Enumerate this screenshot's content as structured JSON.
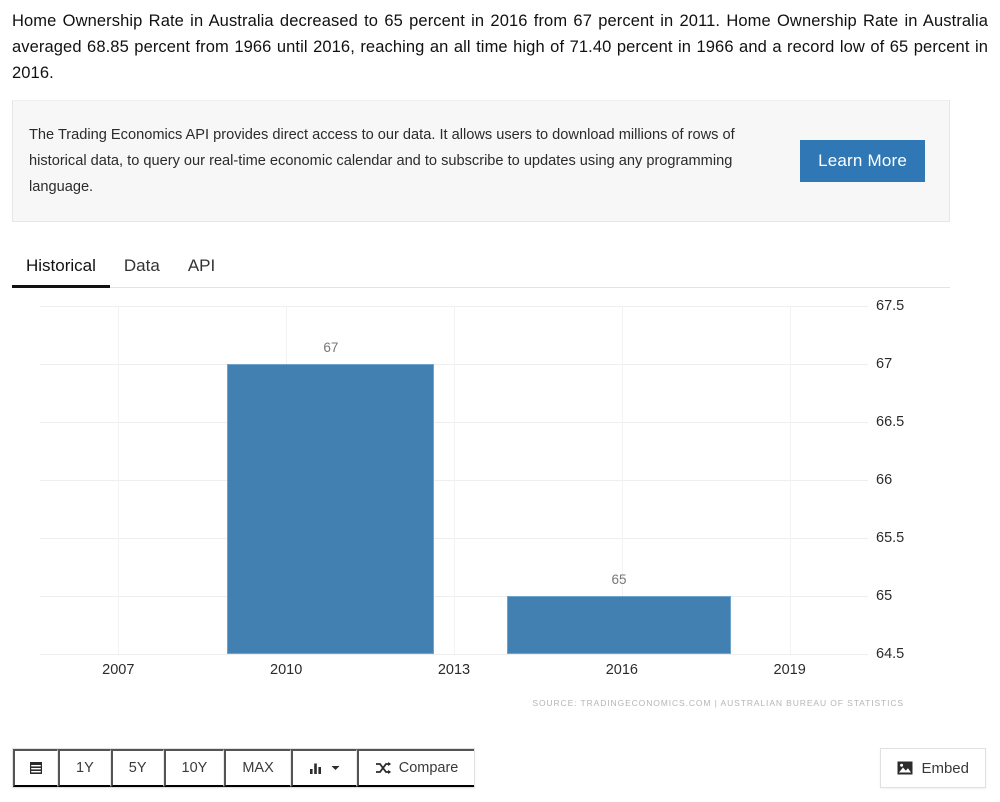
{
  "intro": {
    "text": "Home Ownership Rate in Australia decreased to 65 percent in 2016 from 67 percent in 2011. Home Ownership Rate in Australia averaged 68.85 percent from 1966 until 2016, reaching an all time high of 71.40 percent in 1966 and a record low of 65 percent in 2016."
  },
  "promo": {
    "text": "The Trading Economics API provides direct access to our data. It allows users to download millions of rows of historical data, to query our real-time economic calendar and to subscribe to updates using any programming language.",
    "button_label": "Learn More",
    "button_color": "#2f78b5"
  },
  "tabs": [
    {
      "label": "Historical",
      "active": true
    },
    {
      "label": "Data",
      "active": false
    },
    {
      "label": "API",
      "active": false
    }
  ],
  "toolbar": {
    "calendar_icon": "calendar-icon",
    "ranges": [
      "1Y",
      "5Y",
      "10Y",
      "MAX"
    ],
    "chart_type_icon": "bar-chart-icon",
    "chart_type_caret": "chevron-down-icon",
    "compare_icon": "shuffle-icon",
    "compare_label": "Compare",
    "embed_icon": "image-icon",
    "embed_label": "Embed"
  },
  "chart_data": {
    "type": "bar",
    "title": "",
    "xlabel": "",
    "ylabel": "",
    "categories": [
      "2011",
      "2016"
    ],
    "values": [
      67,
      65
    ],
    "bar_labels": [
      "67",
      "65"
    ],
    "bar_color": "#4180b1",
    "ylim": [
      64.5,
      67.5
    ],
    "yticks": [
      "67.5",
      "67",
      "66.5",
      "66",
      "65.5",
      "65",
      "64.5"
    ],
    "ytick_values": [
      67.5,
      67,
      66.5,
      66,
      65.5,
      65,
      64.5
    ],
    "xticks": [
      "2007",
      "2010",
      "2013",
      "2016",
      "2019"
    ],
    "xtick_values": [
      2007,
      2010,
      2013,
      2016,
      2019
    ],
    "grid": true,
    "legend": false,
    "source": "SOURCE: TRADINGECONOMICS.COM  |  AUSTRALIAN BUREAU OF STATISTICS"
  }
}
